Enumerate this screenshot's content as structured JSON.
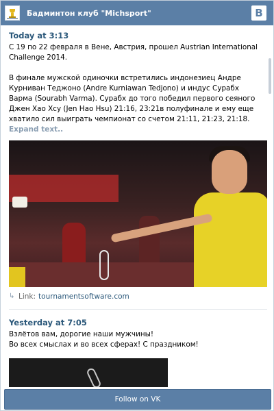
{
  "header": {
    "title": "Бадминтон клуб \"Michsport\"",
    "vk_logo_text": "B"
  },
  "posts": [
    {
      "date": "Today at 3:13",
      "paragraphs": [
        "С 19 по 22 февраля в Вене, Австрия, прошел Austrian International Challenge 2014.",
        "В финале мужской одиночки встретились индонезиец Андре Курниван Теджоно (Andre Kurniawan Tedjono) и индус Сурабх Варма (Sourabh Varma). Сурабх до того победил первого сеяного Джен Хао Хсу (Jen Hao Hsu) 21:16, 23:21в полуфинале и ему еще хватило сил выиграть чемпионат со счетом 21:11, 21:23, 21:18."
      ],
      "expand_label": "Expand text..",
      "link": {
        "prefix": "Link:",
        "url": "tournamentsoftware.com"
      }
    },
    {
      "date": "Yesterday at 7:05",
      "paragraphs": [
        "Взлётов вам, дорогие наши мужчины!",
        "Во всех смыслах и во всех сферах! С праздником!"
      ]
    }
  ],
  "footer": {
    "follow_label": "Follow on VK"
  },
  "colors": {
    "header_bg": "#5b7fa6",
    "date_text": "#2b587a",
    "expand_text": "#8a9eb2"
  },
  "icons": {
    "club_logo": "trophy-icon",
    "vk_logo": "vk-icon",
    "link": "link-arrow-icon"
  }
}
